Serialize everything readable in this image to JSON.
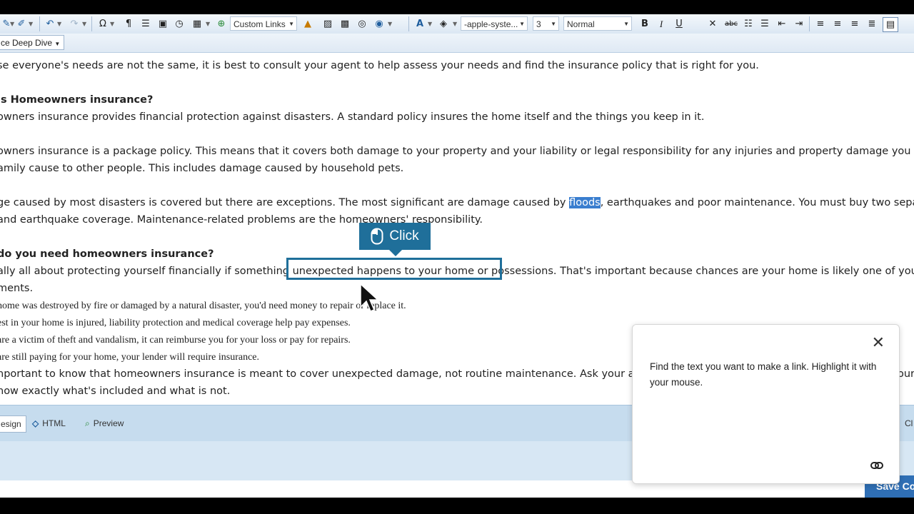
{
  "toolbar": {
    "custom_links": "Custom Links",
    "font_family": "-apple-syste...",
    "font_size": "3",
    "paragraph_style": "Normal"
  },
  "style_dropdown": "ce Deep Dive",
  "content": {
    "line1": "se everyone's needs are not the same, it is best to consult your agent to help assess your needs and find the insurance policy that is right for you.",
    "heading1": " is Homeowners insurance?",
    "line2": "owners insurance provides financial protection against disasters. A standard policy insures the home itself and the things you keep in it.",
    "line3": "owners insurance is a package policy. This means that it covers both damage to your property and your liability or legal responsibility for any injuries and property damage you or me",
    "line4": "amily cause to other people. This includes damage caused by household pets.",
    "line5_before": "ge caused by most disasters is covered but there are exceptions. The most significant are damage caused by ",
    "line5_highlight": "floods",
    "line5_after": ", earthquakes and poor maintenance. You must buy two separate p",
    "line6": "and earthquake coverage. Maintenance-related problems are the homeowners' responsibility.",
    "heading2": "do you need homeowners insurance?",
    "line7": "ally all about protecting yourself financially if something  unexpected happens to your home or possessions. That's important because chances are your home is likely one of your larg",
    "line8": "ments.",
    "line9": " home was destroyed by fire or damaged by a natural disaster, you'd need money to repair or replace it.",
    "line10": "est in your home is injured, liability protection and medical coverage help pay expenses.",
    "line11": "are a victim of theft and vandalism, it can reimburse you for your loss or pay for repairs.",
    "line12": "are still paying for your home, your lender will require insurance.",
    "line13": "nportant to know that homeowners insurance is meant to cover unexpected damage, not routine maintenance. Ask your agent",
    "line13_tail": "our",
    "line14": "how exactly what's included and what is not."
  },
  "callout": {
    "label": "Click"
  },
  "modes": {
    "design": "esign",
    "html": "HTML",
    "preview": "Preview",
    "right_fragment": "Cl"
  },
  "save_button": "Save Co",
  "help_panel": {
    "text": "Find the text you want to make a link. Highlight it with your mouse.",
    "close": "✕"
  },
  "colors": {
    "accent": "#1f6f9a",
    "selection": "#3a7ecf",
    "bar": "#c6dcee"
  }
}
